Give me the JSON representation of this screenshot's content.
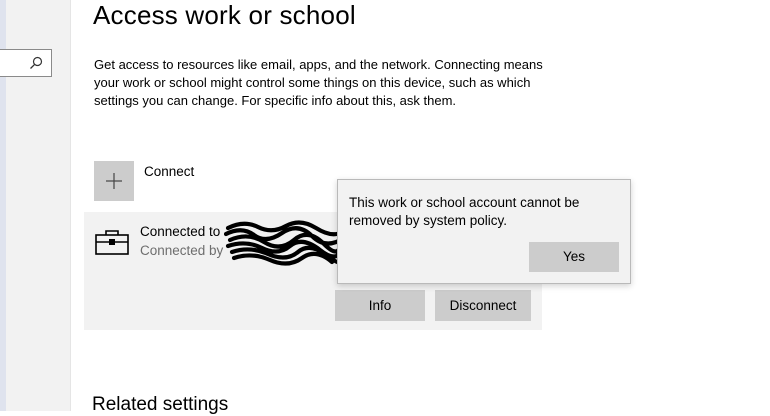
{
  "page": {
    "title": "Access work or school",
    "description": "Get access to resources like email, apps, and the network. Connecting means your work or school might control some things on this device, such as which settings you can change. For specific info about this, ask them."
  },
  "connect": {
    "label": "Connect",
    "icon": "plus-icon"
  },
  "account": {
    "line1": "Connected to",
    "line2": "Connected by",
    "icon": "briefcase-icon",
    "info_label": "Info",
    "disconnect_label": "Disconnect"
  },
  "related_settings": {
    "heading": "Related settings"
  },
  "dialog": {
    "message": "This work or school account cannot be removed by system policy.",
    "yes_label": "Yes"
  },
  "colors": {
    "button_bg": "#cccccc",
    "panel_bg": "#f2f2f2",
    "secondary_text": "#6e6e6e"
  }
}
